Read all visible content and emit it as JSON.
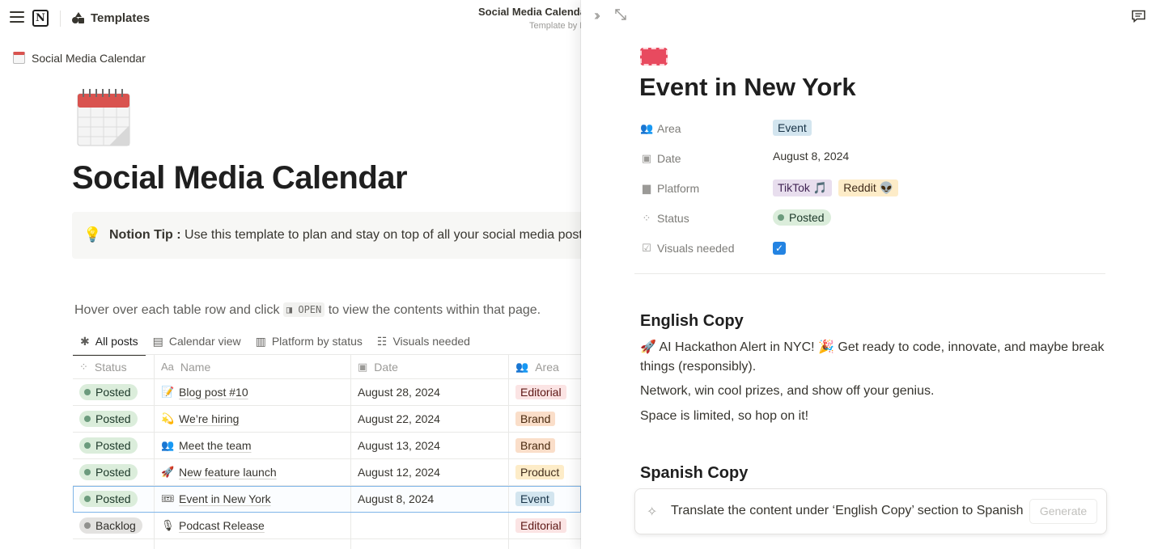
{
  "topbar": {
    "workspace_label": "Templates",
    "page_title": "Social Media Calendar",
    "page_subtitle": "Template by Notion"
  },
  "breadcrumb": {
    "label": "Social Media Calendar"
  },
  "page": {
    "title": "Social Media Calendar",
    "callout": {
      "bold": "Notion Tip :",
      "text": " Use this template to plan and stay on top of all your social media posts."
    },
    "hover_text_before": "Hover over each table row and click ",
    "open_chip": "◨ OPEN",
    "hover_text_after": " to view the contents within that page."
  },
  "views": [
    {
      "label": "All posts",
      "icon": "✱"
    },
    {
      "label": "Calendar view",
      "icon": "▤"
    },
    {
      "label": "Platform by status",
      "icon": "▥"
    },
    {
      "label": "Visuals needed",
      "icon": "☷"
    }
  ],
  "table": {
    "headers": [
      {
        "label": "Status",
        "icon": "⁘"
      },
      {
        "label": "Name",
        "icon": "Aa"
      },
      {
        "label": "Date",
        "icon": "▣"
      },
      {
        "label": "Area",
        "icon": "👥"
      }
    ],
    "rows": [
      {
        "status": "Posted",
        "status_kind": "posted",
        "emoji": "📝",
        "name": "Blog post #10",
        "date": "August 28, 2024",
        "area": "Editorial",
        "area_bg": "#fbe4e4",
        "area_fg": "#5d1715"
      },
      {
        "status": "Posted",
        "status_kind": "posted",
        "emoji": "💫",
        "name": "We’re hiring",
        "date": "August 22, 2024",
        "area": "Brand",
        "area_bg": "#fadec9",
        "area_fg": "#49290e"
      },
      {
        "status": "Posted",
        "status_kind": "posted",
        "emoji": "👥",
        "name": "Meet the team",
        "date": "August 13, 2024",
        "area": "Brand",
        "area_bg": "#fadec9",
        "area_fg": "#49290e"
      },
      {
        "status": "Posted",
        "status_kind": "posted",
        "emoji": "🚀",
        "name": "New feature launch",
        "date": "August 12, 2024",
        "area": "Product",
        "area_bg": "#fdecc8",
        "area_fg": "#402c1b"
      },
      {
        "status": "Posted",
        "status_kind": "posted",
        "emoji": "🎟",
        "name": "Event in New York",
        "date": "August 8, 2024",
        "area": "Event",
        "area_bg": "#d3e5ef",
        "area_fg": "#183347",
        "selected": true
      },
      {
        "status": "Backlog",
        "status_kind": "backlog",
        "emoji": "🎙",
        "name": "Podcast Release",
        "date": "",
        "area": "Editorial",
        "area_bg": "#fbe4e4",
        "area_fg": "#5d1715"
      }
    ]
  },
  "panel": {
    "title": "Event in New York",
    "properties": [
      {
        "label": "Area",
        "icon": "👥"
      },
      {
        "label": "Date",
        "icon": "▣"
      },
      {
        "label": "Platform",
        "icon": "▆"
      },
      {
        "label": "Status",
        "icon": "⁘"
      },
      {
        "label": "Visuals needed",
        "icon": "☑"
      }
    ],
    "area_value": "Event",
    "date_value": "August 8, 2024",
    "platforms": [
      "TikTok 🎵",
      "Reddit 👽"
    ],
    "status_value": "Posted",
    "visuals_checked": "✓",
    "english_heading": "English Copy",
    "english_p1": "🚀 AI Hackathon Alert in NYC! 🎉 Get ready to code, innovate, and maybe break things (responsibly).",
    "english_p2": "Network, win cool prizes, and show off your genius.",
    "english_p3": "Space is limited, so hop on it!",
    "spanish_heading": "Spanish Copy",
    "ai_prompt": "Translate the content under ‘English Copy’ section to Spanish",
    "generate_label": "Generate"
  },
  "colors": {
    "accent_blue": "#2383e2",
    "posted_bg": "#dbeddb",
    "event_tag_bg": "#d3e5ef",
    "tiktok_tag_bg": "#e8deee",
    "reddit_tag_bg": "#fdecc8"
  }
}
